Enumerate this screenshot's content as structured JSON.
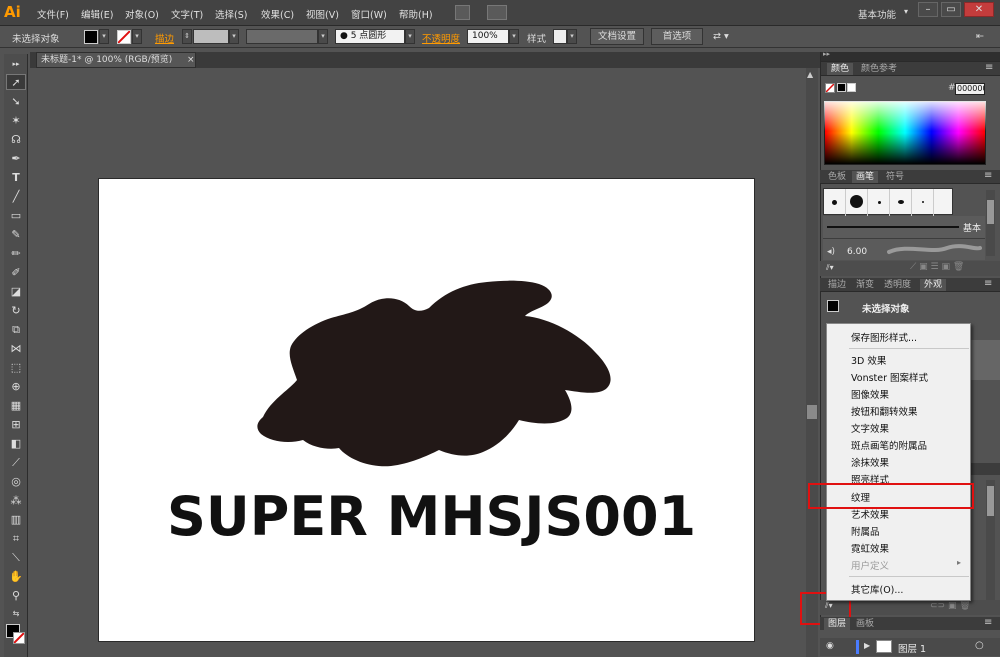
{
  "app": {
    "logo": "Ai"
  },
  "menubar": {
    "items": [
      "文件(F)",
      "编辑(E)",
      "对象(O)",
      "文字(T)",
      "选择(S)",
      "效果(C)",
      "视图(V)",
      "窗口(W)",
      "帮助(H)"
    ],
    "workspace": "基本功能",
    "window_buttons": [
      "–",
      "▭",
      "✕"
    ]
  },
  "control_bar": {
    "selection_label": "未选择对象",
    "stroke_label": "描边",
    "brush_value": "5 点圆形",
    "opacity_label": "不透明度",
    "opacity_value": "100%",
    "style_label": "样式",
    "doc_setup_button": "文档设置",
    "preferences_button": "首选项"
  },
  "document": {
    "tab_title": "未标题-1* @ 100% (RGB/预览)",
    "tab_close": "×",
    "artboard_text": "SUPER MHSJS001"
  },
  "panels": {
    "color": {
      "tabs": [
        "颜色",
        "颜色参考"
      ],
      "hash": "#",
      "hex_value": "000000"
    },
    "brushes": {
      "tabs": [
        "色板",
        "画笔",
        "符号"
      ],
      "basic_label": "基本",
      "size_value": "6.00"
    },
    "appearance": {
      "tabs": [
        "描边",
        "渐变",
        "透明度",
        "外观"
      ],
      "no_selection": "未选择对象"
    },
    "layers": {
      "tabs": [
        "图层",
        "画板"
      ],
      "layer_name": "图层 1"
    }
  },
  "context_menu": {
    "items": [
      {
        "label": "保存图形样式...",
        "disabled": false
      },
      {
        "label": "3D 效果",
        "disabled": false
      },
      {
        "label": "Vonster 图案样式",
        "disabled": false
      },
      {
        "label": "图像效果",
        "disabled": false
      },
      {
        "label": "按钮和翻转效果",
        "disabled": false
      },
      {
        "label": "文字效果",
        "disabled": false
      },
      {
        "label": "斑点画笔的附属品",
        "disabled": false
      },
      {
        "label": "涂抹效果",
        "disabled": false
      },
      {
        "label": "照亮样式",
        "disabled": false
      },
      {
        "label": "纹理",
        "disabled": false
      },
      {
        "label": "艺术效果",
        "disabled": false
      },
      {
        "label": "附属品",
        "disabled": false
      },
      {
        "label": "霓虹效果",
        "disabled": false
      },
      {
        "label": "用户定义",
        "disabled": true
      },
      {
        "label": "其它库(O)...",
        "disabled": false
      }
    ],
    "highlighted": "纹理"
  },
  "colors": {
    "ai_orange": "#ff9a00",
    "highlight_red": "#e01010",
    "blob": "#221817"
  }
}
